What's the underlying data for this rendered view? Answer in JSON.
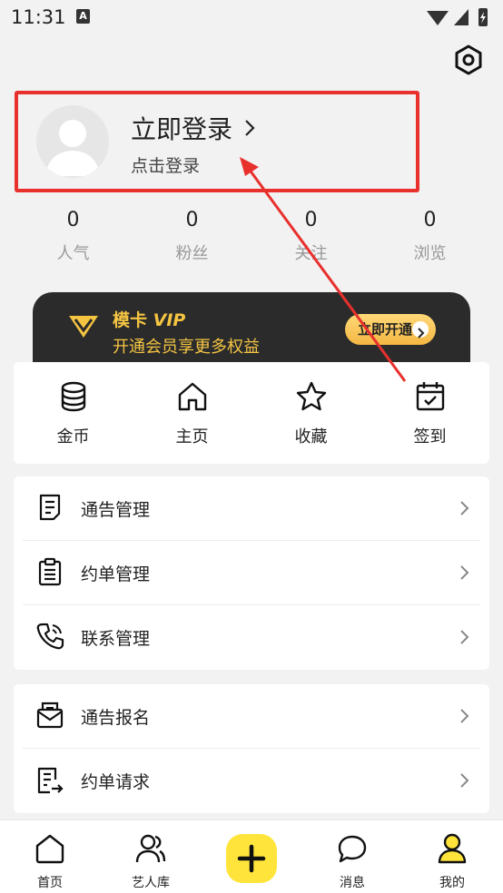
{
  "status": {
    "time": "11:31",
    "notif_letter": "A"
  },
  "header": {
    "settings_icon": "gear-icon"
  },
  "profile": {
    "title": "立即登录",
    "subtitle": "点击登录",
    "avatar_icon": "user-avatar-icon"
  },
  "stats": [
    {
      "value": "0",
      "label": "人气"
    },
    {
      "value": "0",
      "label": "粉丝"
    },
    {
      "value": "0",
      "label": "关注"
    },
    {
      "value": "0",
      "label": "浏览"
    }
  ],
  "vip": {
    "title_prefix": "模卡",
    "title_vip": "VIP",
    "subtitle": "开通会员享更多权益",
    "button": "立即开通"
  },
  "quick": [
    {
      "label": "金币",
      "icon": "coins-icon"
    },
    {
      "label": "主页",
      "icon": "home-icon"
    },
    {
      "label": "收藏",
      "icon": "star-icon"
    },
    {
      "label": "签到",
      "icon": "calendar-check-icon"
    }
  ],
  "menu1": [
    {
      "label": "通告管理",
      "icon": "document-icon"
    },
    {
      "label": "约单管理",
      "icon": "clipboard-icon"
    },
    {
      "label": "联系管理",
      "icon": "phone-icon"
    }
  ],
  "menu2": [
    {
      "label": "通告报名",
      "icon": "mail-icon"
    },
    {
      "label": "约单请求",
      "icon": "list-export-icon"
    }
  ],
  "tabbar": [
    {
      "label": "首页",
      "icon": "home-tab-icon"
    },
    {
      "label": "艺人库",
      "icon": "people-icon"
    },
    {
      "label": "",
      "icon": "plus-icon"
    },
    {
      "label": "消息",
      "icon": "chat-icon"
    },
    {
      "label": "我的",
      "icon": "person-icon"
    }
  ],
  "colors": {
    "accent": "#ffe53b",
    "vip_gold": "#f5c542",
    "highlight": "#e8302d",
    "vip_bg": "#2b2b2b"
  }
}
